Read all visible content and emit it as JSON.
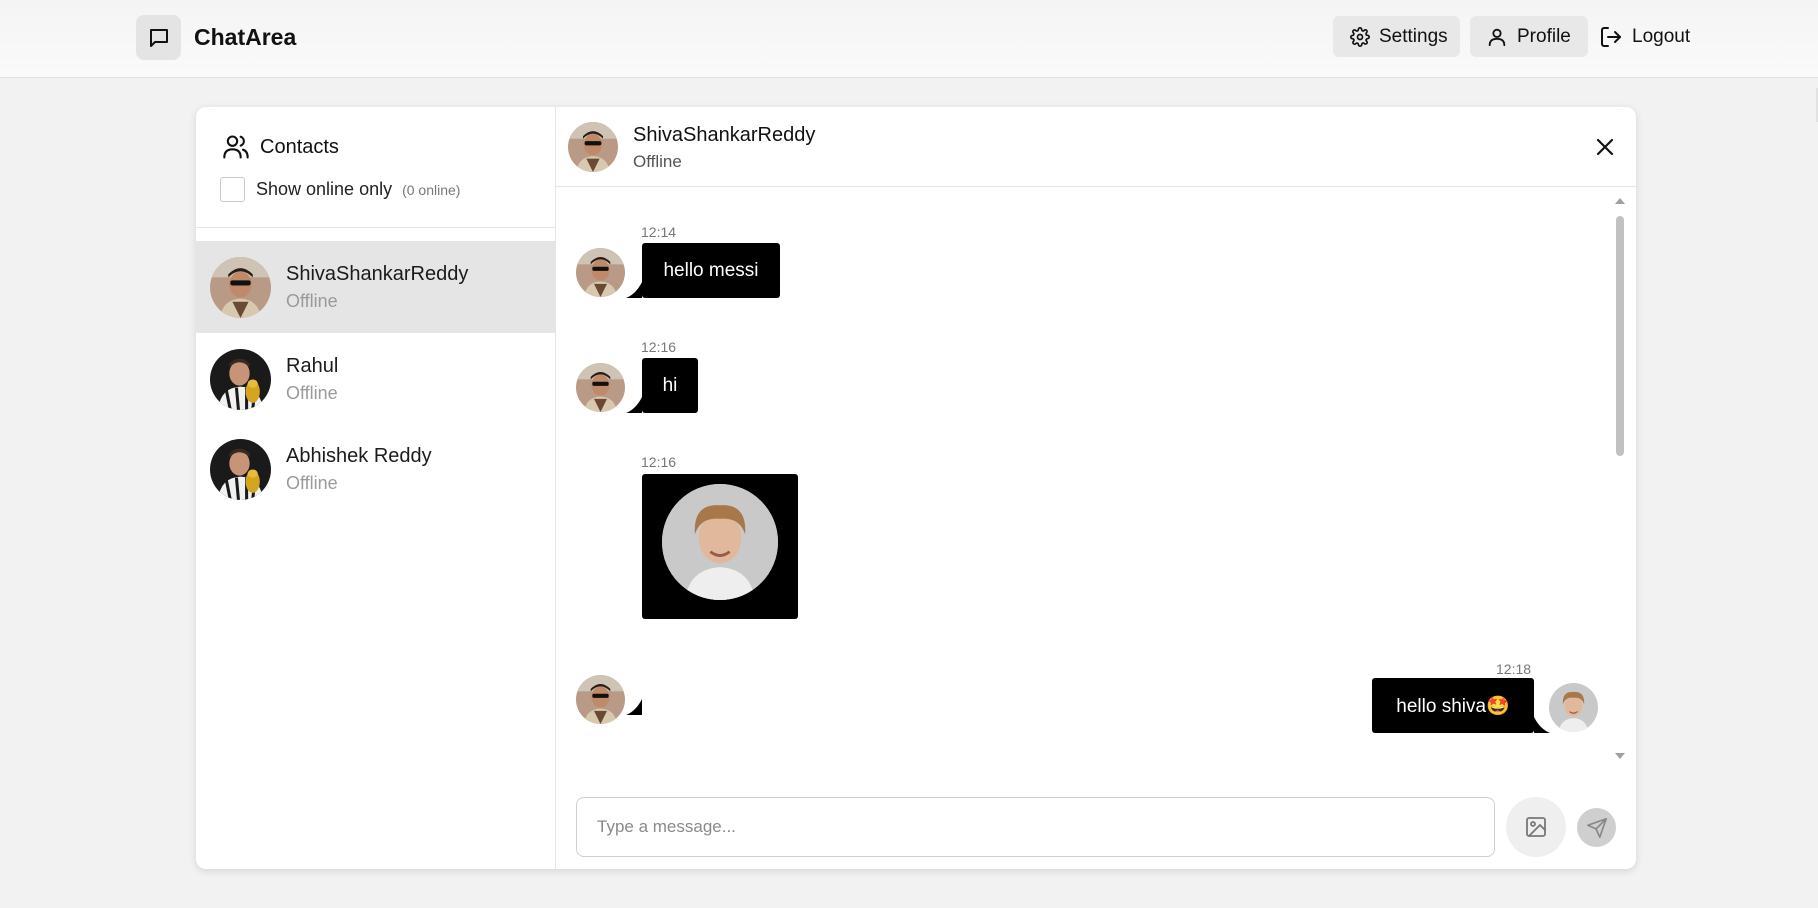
{
  "app": {
    "name": "ChatArea"
  },
  "nav": {
    "settings_label": "Settings",
    "profile_label": "Profile",
    "logout_label": "Logout"
  },
  "sidebar": {
    "title": "Contacts",
    "filter_label": "Show online only",
    "online_count": "(0 online)",
    "contacts": [
      {
        "name": "ShivaShankarReddy",
        "status": "Offline",
        "selected": true
      },
      {
        "name": "Rahul",
        "status": "Offline",
        "selected": false
      },
      {
        "name": "Abhishek Reddy",
        "status": "Offline",
        "selected": false
      }
    ]
  },
  "chat": {
    "header": {
      "name": "ShivaShankarReddy",
      "status": "Offline"
    },
    "messages": [
      {
        "direction": "incoming",
        "time": "12:14",
        "type": "text",
        "text": "hello messi"
      },
      {
        "direction": "incoming",
        "time": "12:16",
        "type": "text",
        "text": "hi"
      },
      {
        "direction": "incoming",
        "time": "12:16",
        "type": "image"
      },
      {
        "direction": "outgoing",
        "time": "12:18",
        "type": "text",
        "text": "hello shiva🤩"
      }
    ],
    "input": {
      "placeholder": "Type a message...",
      "value": ""
    }
  },
  "colors": {
    "bubble": "#000000",
    "selected_contact_bg": "#e5e5e5",
    "page_bg": "#f2f2f2"
  }
}
